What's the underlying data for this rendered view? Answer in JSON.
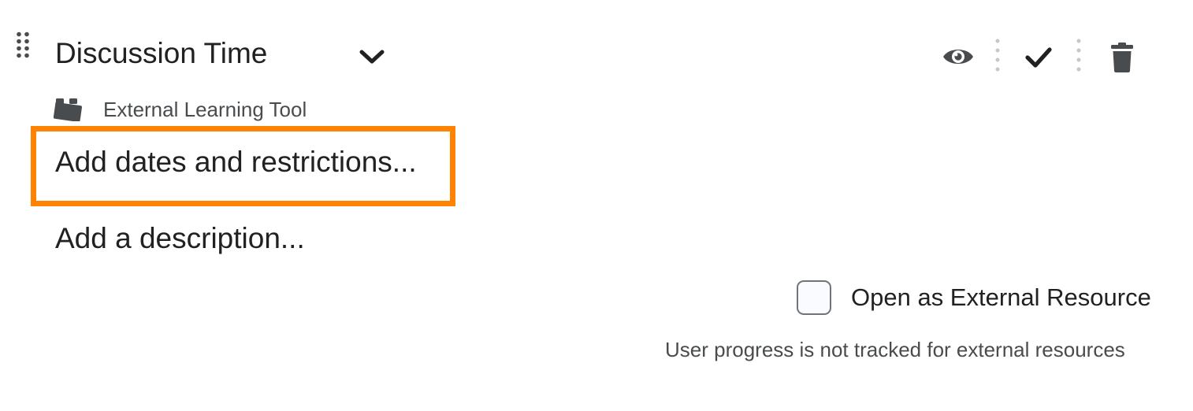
{
  "item": {
    "title": "Discussion Time",
    "type_label": "External Learning Tool"
  },
  "actions": {
    "add_dates": "Add dates and restrictions...",
    "add_description": "Add a description..."
  },
  "toolbar": {
    "icons": [
      "eye-icon",
      "checkmark-icon",
      "trash-icon"
    ]
  },
  "external_option": {
    "label": "Open as External Resource",
    "checked": false,
    "helper": "User progress is not tracked for external resources"
  },
  "colors": {
    "highlight": "#ff8200",
    "text": "#202122",
    "muted_text": "#494c4e",
    "icon": "#494c4e"
  }
}
